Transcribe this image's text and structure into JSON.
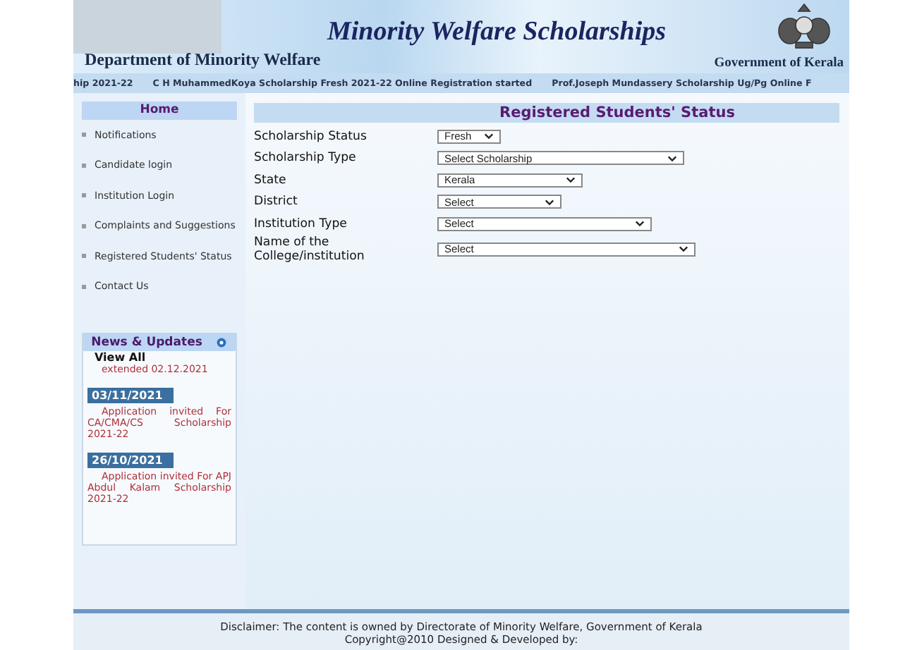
{
  "header": {
    "title": "Minority Welfare Scholarships",
    "department": "Department of Minority Welfare",
    "government": "Government of Kerala"
  },
  "ticker": [
    "hip 2021-22",
    "C H MuhammedKoya Scholarship Fresh 2021-22 Online Registration started",
    "Prof.Joseph Mundassery Scholarship Ug/Pg Online F"
  ],
  "sidebar": {
    "home": "Home",
    "items": [
      "Notifications",
      "Candidate login",
      "Institution Login",
      "Complaints and Suggestions",
      "Registered Students' Status",
      "Contact Us"
    ]
  },
  "news": {
    "title": "News & Updates",
    "view_all": "View All",
    "items": [
      {
        "text": "extended 02.12.2021"
      },
      {
        "date": "03/11/2021",
        "text": "Application invited For CA/CMA/CS Scholarship 2021-22"
      },
      {
        "date": "26/10/2021",
        "text": "Application invited For APJ Abdul Kalam Scholarship 2021-22"
      }
    ]
  },
  "form": {
    "title": "Registered Students' Status",
    "fields": [
      {
        "label": "Scholarship Status",
        "value": "Fresh"
      },
      {
        "label": "Scholarship Type",
        "value": "Select Scholarship"
      },
      {
        "label": "State",
        "value": "Kerala"
      },
      {
        "label": "District",
        "value": "Select"
      },
      {
        "label": "Institution Type",
        "value": "Select"
      },
      {
        "label": "Name of the College/institution",
        "value": "Select"
      }
    ]
  },
  "footer": {
    "disclaimer": "Disclaimer: The content is owned by Directorate of Minority Welfare, Government of Kerala",
    "copyright": "Copyright@2010 Designed & Developed by:"
  }
}
